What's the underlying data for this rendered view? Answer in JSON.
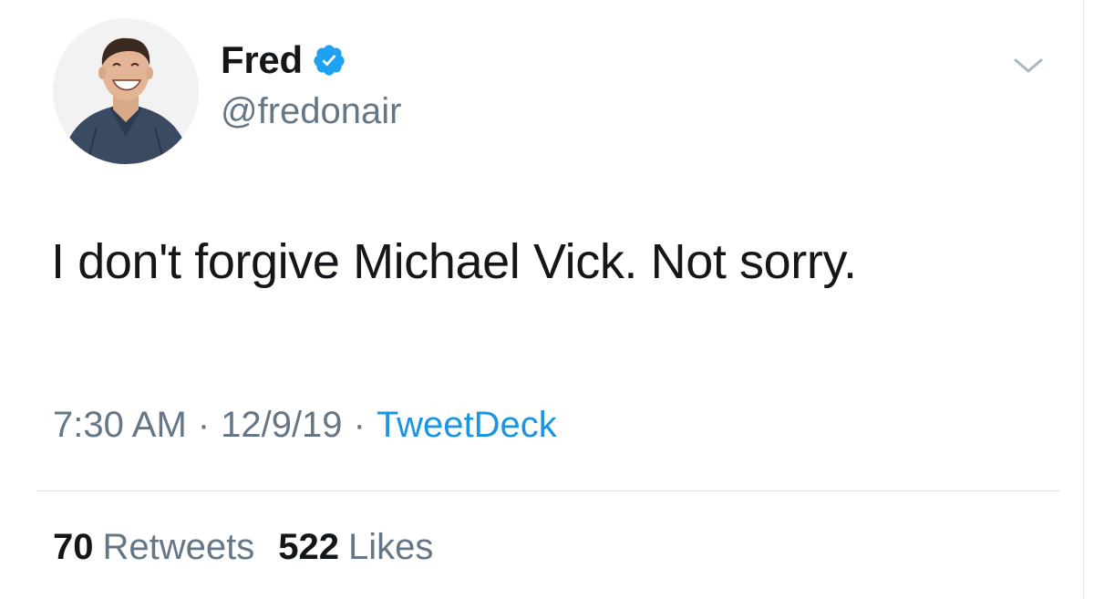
{
  "author": {
    "display_name": "Fred",
    "handle": "@fredonair",
    "verified": true,
    "avatar_icon": "profile-photo"
  },
  "tweet": {
    "text": "I don't forgive Michael Vick. Not sorry."
  },
  "meta": {
    "time": "7:30 AM",
    "separator": "·",
    "date": "12/9/19",
    "source": "TweetDeck"
  },
  "stats": {
    "retweets_count": "70",
    "retweets_label": "Retweets",
    "likes_count": "522",
    "likes_label": "Likes"
  },
  "colors": {
    "verified_badge": "#1da1f2",
    "link": "#1b95e0",
    "secondary_text": "#657786",
    "primary_text": "#14171a"
  },
  "icons": {
    "menu": "chevron-down-icon",
    "verified": "verified-badge-icon"
  }
}
